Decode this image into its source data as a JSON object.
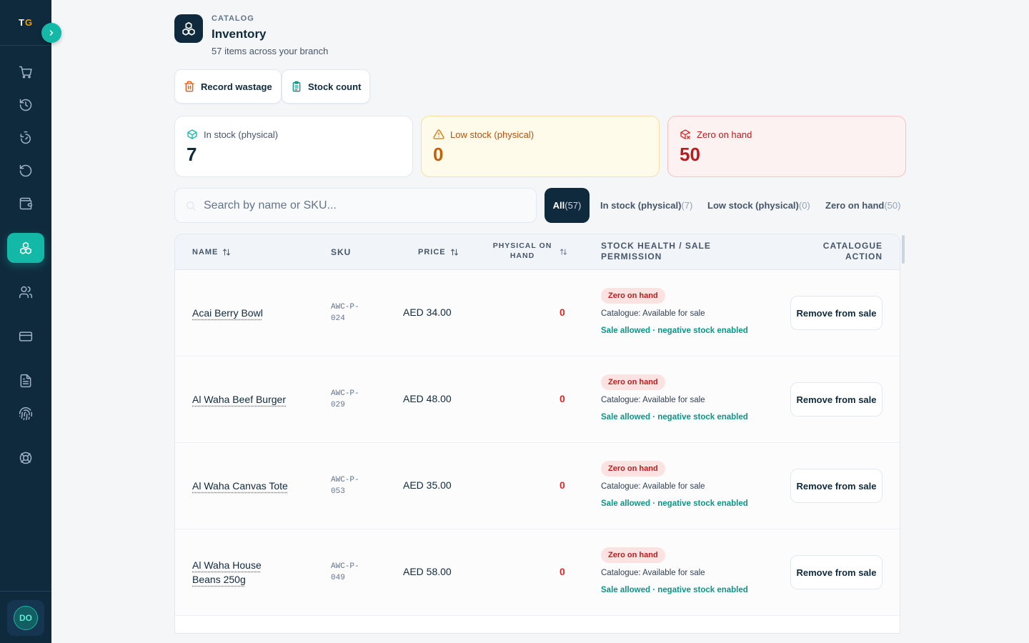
{
  "brand": {
    "text_main": "T",
    "text_accent": "G"
  },
  "sidebar": {
    "items": [
      {
        "icon": "cart-icon",
        "name": "sidebar-item-sales"
      },
      {
        "icon": "history-icon",
        "name": "sidebar-item-history"
      },
      {
        "icon": "timer-icon",
        "name": "sidebar-item-shifts"
      },
      {
        "icon": "refund-icon",
        "name": "sidebar-item-returns"
      },
      {
        "icon": "wallet-icon",
        "name": "sidebar-item-cash"
      },
      {
        "icon": "inventory-icon",
        "name": "sidebar-item-inventory",
        "active": true
      },
      {
        "icon": "users-icon",
        "name": "sidebar-item-customers"
      },
      {
        "icon": "card-icon",
        "name": "sidebar-item-payments"
      },
      {
        "icon": "document-icon",
        "name": "sidebar-item-reports"
      },
      {
        "icon": "fingerprint-icon",
        "name": "sidebar-item-security"
      },
      {
        "icon": "lifebuoy-icon",
        "name": "sidebar-item-support"
      }
    ],
    "user_initials": "DO"
  },
  "header": {
    "eyebrow": "CATALOG",
    "title": "Inventory",
    "subtitle": "57 items across your branch"
  },
  "actions": {
    "record_wastage": "Record wastage",
    "stock_count": "Stock count"
  },
  "stats": {
    "in_stock": {
      "label": "In stock (physical)",
      "value": "7"
    },
    "low_stock": {
      "label": "Low stock (physical)",
      "value": "0"
    },
    "zero": {
      "label": "Zero on hand",
      "value": "50"
    }
  },
  "search": {
    "placeholder": "Search by name or SKU..."
  },
  "filters": [
    {
      "label": "All",
      "count": "(57)"
    },
    {
      "label": "In stock (physical)",
      "count": "(7)"
    },
    {
      "label": "Low stock (physical)",
      "count": "(0)"
    },
    {
      "label": "Zero on hand",
      "count": "(50)"
    }
  ],
  "table": {
    "headers": {
      "name": "NAME",
      "sku": "SKU",
      "price": "PRICE",
      "physical_1": "PHYSICAL ON",
      "physical_2": "HAND",
      "health_1": "STOCK HEALTH / SALE",
      "health_2": "PERMISSION",
      "action_1": "CATALOGUE",
      "action_2": "ACTION"
    },
    "rows": [
      {
        "name": "Acai Berry Bowl",
        "sku_1": "AWC-P-",
        "sku_2": "024",
        "price": "AED 34.00",
        "qty": "0",
        "badge": "Zero on hand",
        "catalogue": "Catalogue: Available for sale",
        "sale": "Sale allowed · negative stock enabled",
        "action": "Remove from sale"
      },
      {
        "name": "Al Waha Beef Burger",
        "sku_1": "AWC-P-",
        "sku_2": "029",
        "price": "AED 48.00",
        "qty": "0",
        "badge": "Zero on hand",
        "catalogue": "Catalogue: Available for sale",
        "sale": "Sale allowed · negative stock enabled",
        "action": "Remove from sale"
      },
      {
        "name": "Al Waha Canvas Tote",
        "sku_1": "AWC-P-",
        "sku_2": "053",
        "price": "AED 35.00",
        "qty": "0",
        "badge": "Zero on hand",
        "catalogue": "Catalogue: Available for sale",
        "sale": "Sale allowed · negative stock enabled",
        "action": "Remove from sale"
      },
      {
        "name": "Al Waha House Beans 250g",
        "sku_1": "AWC-P-",
        "sku_2": "049",
        "price": "AED 58.00",
        "qty": "0",
        "badge": "Zero on hand",
        "catalogue": "Catalogue: Available for sale",
        "sale": "Sale allowed · negative stock enabled",
        "action": "Remove from sale"
      }
    ]
  },
  "colors": {
    "sidebar_bg": "#0f2a3d",
    "accent": "#14b8a6",
    "danger": "#dc2626",
    "warning": "#c2620a"
  }
}
